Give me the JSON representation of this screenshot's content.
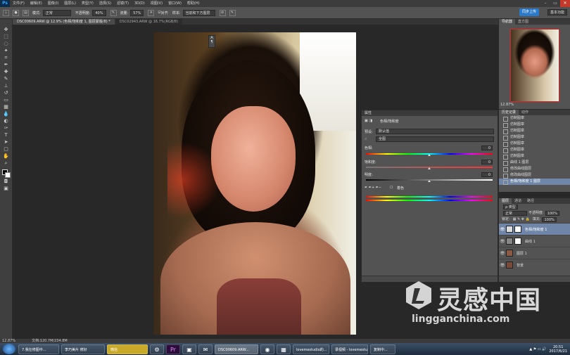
{
  "menubar": {
    "logo": "Ps",
    "items": [
      "文件(F)",
      "编辑(E)",
      "图像(I)",
      "图层(L)",
      "类型(Y)",
      "选择(S)",
      "滤镜(T)",
      "3D(D)",
      "视图(V)",
      "窗口(W)",
      "帮助(H)"
    ]
  },
  "options": {
    "mode_label": "模式:",
    "mode_value": "正常",
    "opacity_label": "不透明度:",
    "opacity_value": "40%",
    "flow_label": "流量:",
    "flow_value": "57%",
    "align_label": "对齐",
    "sample_label": "样本:",
    "sample_value": "当前和下方图层",
    "cloud_button": "同步上传",
    "workspace": "基本功能"
  },
  "tabs": [
    {
      "label": "DSC00609.ARW @ 12.9% (色相/饱和度 1, 图层蒙版/8) *",
      "active": true
    },
    {
      "label": "DSC02943.ARW @ 16.7%(RGB/8)",
      "active": false
    }
  ],
  "properties": {
    "title": "属性",
    "adjust_name": "色相/饱和度",
    "preset_label": "预设:",
    "preset_value": "默认值",
    "channel_value": "全图",
    "hue_label": "色相:",
    "hue_value": "0",
    "saturation_label": "饱和度:",
    "saturation_value": "0",
    "lightness_label": "明度:",
    "lightness_value": "0",
    "colorize_label": "着色"
  },
  "navigator": {
    "tab_navigator": "导航器",
    "tab_histogram": "直方图",
    "zoom": "12.87%"
  },
  "history": {
    "tab_history": "历史记录",
    "tab_actions": "动作",
    "items": [
      "仿制图章",
      "仿制图章",
      "仿制图章",
      "仿制图章",
      "仿制图章",
      "仿制图章",
      "仿制图章",
      "曲线 1 图层",
      "修改曲线图层",
      "修改曲线图层",
      "色相/饱和度 1 图层"
    ]
  },
  "layers": {
    "tab_layers": "图层",
    "tab_channels": "通道",
    "tab_paths": "路径",
    "kind_label": "ρ 类型",
    "blend": "正常",
    "opacity_label": "不透明度:",
    "opacity_value": "100%",
    "lock_label": "锁定:",
    "fill_label": "填充:",
    "fill_value": "100%",
    "items": [
      {
        "name": "色相/饱和度 1",
        "active": true
      },
      {
        "name": "曲线 1",
        "active": false
      },
      {
        "name": "图层 1",
        "active": false
      },
      {
        "name": "背景",
        "active": false
      }
    ]
  },
  "statusbar": {
    "zoom": "12.87%",
    "doc": "文档:120.7M/234.8M"
  },
  "watermark": {
    "text": "灵感中国",
    "url": "lingganchina.com"
  },
  "taskbar": {
    "items": [
      {
        "label": "7.我在修图中...",
        "icon": false
      },
      {
        "label": "李巧美片 修好",
        "icon": false
      },
      {
        "label": "微信",
        "icon": false
      },
      {
        "label": "⚙",
        "icon": true
      },
      {
        "label": "Pr",
        "icon": true
      },
      {
        "label": "▣",
        "icon": true
      },
      {
        "label": "✉",
        "icon": true
      },
      {
        "label": "DSC00609.ARW...",
        "icon": false,
        "active": true
      },
      {
        "label": "◉",
        "icon": true
      },
      {
        "label": "▦",
        "icon": true
      },
      {
        "label": "lovemestudio的...",
        "icon": false
      },
      {
        "label": "录视频 - lovemestu...",
        "icon": false
      },
      {
        "label": "复制中...",
        "icon": false
      }
    ],
    "time": "20:51",
    "date": "2017/6/21"
  }
}
